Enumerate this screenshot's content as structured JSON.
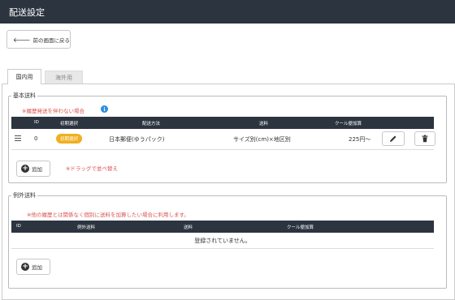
{
  "header": {
    "title": "配送設定"
  },
  "back_button": {
    "icon": "arrow-left-icon",
    "label": "前の画面に戻る"
  },
  "tabs": [
    {
      "label": "国内用",
      "active": true
    },
    {
      "label": "海外用",
      "active": false
    }
  ],
  "basic": {
    "legend": "基本送料",
    "note": "※履歴発送を伴わない場合",
    "columns": [
      "ID",
      "初期選択",
      "配送方法",
      "送料",
      "クール便加算"
    ],
    "rows": [
      {
        "id": "0",
        "badge": "初期選択",
        "method": "日本郵便(ゆうパック)",
        "shipping": "サイズ別(cm)×地区別",
        "cool": "225円〜"
      }
    ],
    "add_label": "追加",
    "drag_hint": "※ドラッグで並べ替え"
  },
  "exception": {
    "legend": "例外送料",
    "note": "※他の履歴とは関係なく個別に送料を加算したい場合に利用します。",
    "columns": [
      "ID",
      "例外送料",
      "送料",
      "クール便加算"
    ],
    "empty_text": "登録されていません。",
    "add_label": "追加"
  },
  "colors": {
    "header_bg": "#2c3440",
    "badge": "#f0b020",
    "note": "#d9534f",
    "info": "#2b8de0"
  }
}
